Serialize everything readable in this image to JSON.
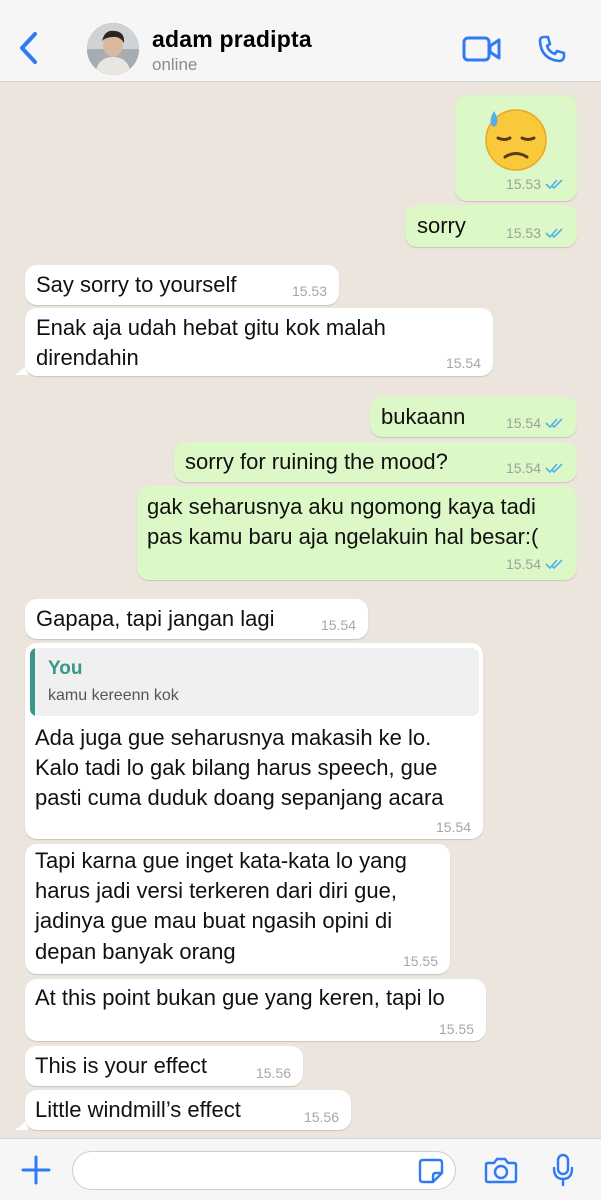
{
  "header": {
    "contact_name": "adam pradipta",
    "status": "online",
    "icons": [
      "back-chevron-icon",
      "video-call-icon",
      "voice-call-icon"
    ]
  },
  "messages": [
    {
      "dir": "out",
      "kind": "emoji",
      "emoji": "sad-sweat-face",
      "time": "15.53",
      "read": true
    },
    {
      "dir": "out",
      "text": "sorry",
      "time": "15.53",
      "read": true
    },
    {
      "dir": "in",
      "text": "Say sorry to yourself",
      "time": "15.53"
    },
    {
      "dir": "in",
      "lines": [
        "Enak aja udah hebat gitu kok malah",
        "direndahin"
      ],
      "time": "15.54"
    },
    {
      "dir": "out",
      "text": "bukaann",
      "time": "15.54",
      "read": true
    },
    {
      "dir": "out",
      "text": "sorry for ruining the mood?",
      "time": "15.54",
      "read": true
    },
    {
      "dir": "out",
      "lines": [
        "gak seharusnya aku ngomong kaya tadi",
        "pas kamu baru aja ngelakuin hal besar:("
      ],
      "time": "15.54",
      "read": true
    },
    {
      "dir": "in",
      "text": "Gapapa, tapi jangan lagi",
      "time": "15.54"
    },
    {
      "dir": "in",
      "quote": {
        "author": "You",
        "text": "kamu kereenn kok"
      },
      "lines": [
        "Ada juga gue seharusnya makasih ke lo.",
        "Kalo tadi lo gak bilang harus speech, gue",
        "pasti cuma duduk doang sepanjang acara"
      ],
      "time": "15.54"
    },
    {
      "dir": "in",
      "lines": [
        "Tapi karna gue inget kata-kata lo yang",
        "harus jadi versi terkeren dari diri gue,",
        "jadinya gue mau buat ngasih opini di",
        "depan banyak orang"
      ],
      "time": "15.55"
    },
    {
      "dir": "in",
      "text": "At this point bukan gue yang keren, tapi lo",
      "time": "15.55"
    },
    {
      "dir": "in",
      "text": "This is your effect",
      "time": "15.56"
    },
    {
      "dir": "in",
      "text": "Little windmill’s effect",
      "time": "15.56"
    }
  ],
  "composer": {
    "input_value": "",
    "icons": [
      "plus-icon",
      "sticker-icon",
      "camera-icon",
      "microphone-icon"
    ]
  },
  "colors": {
    "outgoing_bubble": "#dcf8c6",
    "incoming_bubble": "#ffffff",
    "chat_background": "#ece5dd",
    "accent_blue": "#2f7bf5",
    "read_ticks": "#4fb3e8",
    "quote_accent": "#35988a"
  }
}
